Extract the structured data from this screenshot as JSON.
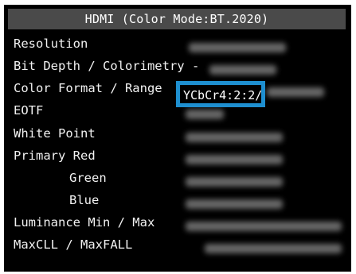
{
  "title": "HDMI (Color Mode:BT.2020)",
  "rows": [
    {
      "label": "Resolution"
    },
    {
      "label": "Bit Depth / Colorimetry -"
    },
    {
      "label": "Color Format / Range"
    },
    {
      "label": "EOTF"
    },
    {
      "label": "White Point"
    },
    {
      "label": "Primary Red"
    },
    {
      "label": "Green"
    },
    {
      "label": "Blue"
    },
    {
      "label": "Luminance  Min / Max"
    },
    {
      "label": "MaxCLL / MaxFALL"
    }
  ],
  "highlight": {
    "value": "YCbCr4:2:2/",
    "border_color": "#1e8fd0"
  },
  "colors": {
    "panel_bg": "#000000",
    "title_bar_bg": "#4a4a4a",
    "text": "#f2f2f2"
  }
}
